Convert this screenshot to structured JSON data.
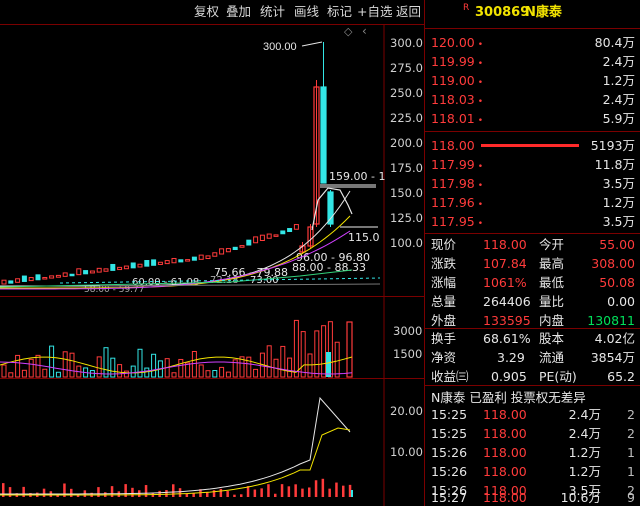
{
  "toolbar": {
    "b1": "复权",
    "b2": "叠加",
    "b3": "统计",
    "b4": "画线",
    "b5": "标记",
    "b6": "+自选",
    "b7": "返回"
  },
  "colors": {
    "up": "#ff3b3b",
    "down": "#00e05a",
    "cyan": "#33e6e6",
    "yellow": "#f2e300",
    "grid": "#7a0000",
    "purple": "#d040ff",
    "white": "#e6e6e6"
  },
  "stock": {
    "flag": "R",
    "code": "300869",
    "name": "N康泰"
  },
  "asks": [
    {
      "price": "120.00",
      "vol": "80.4万"
    },
    {
      "price": "119.99",
      "vol": "2.4万"
    },
    {
      "price": "119.00",
      "vol": "1.2万"
    },
    {
      "price": "118.03",
      "vol": "2.4万"
    },
    {
      "price": "118.01",
      "vol": "5.9万"
    }
  ],
  "bids": [
    {
      "price": "118.00",
      "vol": "5193万"
    },
    {
      "price": "117.99",
      "vol": "11.8万"
    },
    {
      "price": "117.98",
      "vol": "3.5万"
    },
    {
      "price": "117.96",
      "vol": "1.2万"
    },
    {
      "price": "117.95",
      "vol": "3.5万"
    }
  ],
  "quote": {
    "l1": "现价",
    "v1": "118.00",
    "l2": "今开",
    "v2": "55.00",
    "l3": "涨跌",
    "v3": "107.84",
    "l4": "最高",
    "v4": "308.00",
    "l5": "涨幅",
    "v5": "1061%",
    "l6": "最低",
    "v6": "50.08",
    "l7": "总量",
    "v7": "264406",
    "l8": "量比",
    "v8": "0.00",
    "l9": "外盘",
    "v9": "133595",
    "l10": "内盘",
    "v10": "130811",
    "l11": "换手",
    "v11": "68.61%",
    "l12": "股本",
    "v12": "4.02亿",
    "l13": "净资",
    "v13": "3.29",
    "l14": "流通",
    "v14": "3854万",
    "l15": "收益㈢",
    "v15": "0.905",
    "l16": "PE(动)",
    "v16": "65.2"
  },
  "tip": "N康泰 已盈利 投票权无差异",
  "ticks": [
    {
      "t": "15:25",
      "p": "118.00",
      "v": "2.4万",
      "n": "2"
    },
    {
      "t": "15:25",
      "p": "118.00",
      "v": "2.4万",
      "n": "2"
    },
    {
      "t": "15:26",
      "p": "118.00",
      "v": "1.2万",
      "n": "1"
    },
    {
      "t": "15:26",
      "p": "118.00",
      "v": "1.2万",
      "n": "1"
    },
    {
      "t": "15:26",
      "p": "118.00",
      "v": "3.5万",
      "n": "2"
    },
    {
      "t": "15:27",
      "p": "118.00",
      "v": "10.6万",
      "n": "9"
    }
  ],
  "price_axis": [
    "300.0",
    "275.0",
    "250.0",
    "225.0",
    "200.0",
    "175.0",
    "150.0",
    "125.0",
    "100.0"
  ],
  "vol_axis": [
    "3000",
    "1500"
  ],
  "ind_axis": [
    "20.00",
    "10.00"
  ],
  "annotations": {
    "high": "300.00",
    "a2": "159.00 - 1",
    "a3": "115.0",
    "a4": "96.00 - 96.80",
    "a5": "88.00 - 88.33",
    "a6": "75.66 - 79.88",
    "a7": "72.18",
    "a8": "73.00",
    "a9": "60.00 - 61.08",
    "a10": "58.00 - 59.77"
  },
  "chart_data": [
    {
      "type": "candlestick",
      "description": "daily K-line, price axis 100-300",
      "ylim": [
        75,
        310
      ],
      "candles_recent": [
        {
          "o": 90,
          "h": 100,
          "l": 88,
          "c": 96
        },
        {
          "o": 96,
          "h": 118,
          "l": 94,
          "c": 115
        },
        {
          "o": 118,
          "h": 262,
          "l": 115,
          "c": 255
        },
        {
          "o": 255,
          "h": 300,
          "l": 159,
          "c": 159
        },
        {
          "o": 150,
          "h": 152,
          "l": 115,
          "c": 118
        }
      ]
    },
    {
      "type": "bar",
      "description": "volume",
      "ylim": [
        0,
        3500
      ]
    },
    {
      "type": "line",
      "description": "indicator",
      "ylim": [
        0,
        24
      ]
    }
  ]
}
